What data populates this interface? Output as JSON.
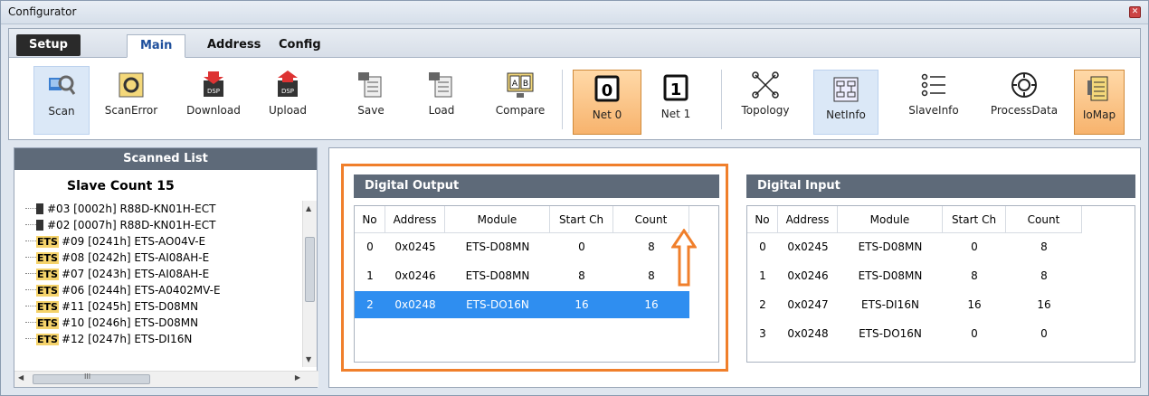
{
  "window": {
    "title": "Configurator"
  },
  "tabs": {
    "setup": "Setup",
    "main": "Main",
    "address": "Address",
    "config": "Config"
  },
  "toolbar": [
    {
      "label": "Scan",
      "icon": "scan-icon"
    },
    {
      "label": "ScanError",
      "icon": "scan-error-icon"
    },
    {
      "label": "Download",
      "icon": "download-icon"
    },
    {
      "label": "Upload",
      "icon": "upload-icon"
    },
    {
      "label": "Save",
      "icon": "save-icon"
    },
    {
      "label": "Load",
      "icon": "load-icon"
    },
    {
      "label": "Compare",
      "icon": "compare-icon"
    },
    {
      "label": "Net 0",
      "glyph": "0",
      "icon": "net0-icon"
    },
    {
      "label": "Net 1",
      "glyph": "1",
      "icon": "net1-icon"
    },
    {
      "label": "Topology",
      "icon": "topology-icon"
    },
    {
      "label": "NetInfo",
      "icon": "netinfo-icon"
    },
    {
      "label": "SlaveInfo",
      "icon": "slaveinfo-icon"
    },
    {
      "label": "ProcessData",
      "icon": "processdata-icon"
    },
    {
      "label": "IoMap",
      "icon": "iomap-icon"
    }
  ],
  "scanned": {
    "header": "Scanned List",
    "slave_count": "Slave Count  15",
    "items": [
      {
        "badge": "chip",
        "text": "#03  [0002h] R88D-KN01H-ECT"
      },
      {
        "badge": "chip",
        "text": "#02  [0007h] R88D-KN01H-ECT"
      },
      {
        "badge": "ETS",
        "text": "#09  [0241h] ETS-AO04V-E"
      },
      {
        "badge": "ETS",
        "text": "#08  [0242h] ETS-AI08AH-E"
      },
      {
        "badge": "ETS",
        "text": "#07  [0243h] ETS-AI08AH-E"
      },
      {
        "badge": "ETS",
        "text": "#06  [0244h] ETS-A0402MV-E"
      },
      {
        "badge": "ETS",
        "text": "#11  [0245h] ETS-D08MN"
      },
      {
        "badge": "ETS",
        "text": "#10  [0246h] ETS-D08MN"
      },
      {
        "badge": "ETS",
        "text": "#12  [0247h] ETS-DI16N"
      }
    ],
    "hscroll_glyph": "III"
  },
  "digital_output": {
    "header": "Digital Output",
    "columns": [
      "No",
      "Address",
      "Module",
      "Start Ch",
      "Count"
    ],
    "rows": [
      [
        "0",
        "0x0245",
        "ETS-D08MN",
        "0",
        "8"
      ],
      [
        "1",
        "0x0246",
        "ETS-D08MN",
        "8",
        "8"
      ],
      [
        "2",
        "0x0248",
        "ETS-DO16N",
        "16",
        "16"
      ]
    ],
    "selected_row": 2
  },
  "digital_input": {
    "header": "Digital Input",
    "columns": [
      "No",
      "Address",
      "Module",
      "Start Ch",
      "Count"
    ],
    "rows": [
      [
        "0",
        "0x0245",
        "ETS-D08MN",
        "0",
        "8"
      ],
      [
        "1",
        "0x0246",
        "ETS-D08MN",
        "8",
        "8"
      ],
      [
        "2",
        "0x0247",
        "ETS-DI16N",
        "16",
        "16"
      ],
      [
        "3",
        "0x0248",
        "ETS-DO16N",
        "0",
        "0"
      ]
    ]
  },
  "colors": {
    "accent": "#f07f2b",
    "selection": "#2f8ef0",
    "header": "#5e6a79"
  }
}
